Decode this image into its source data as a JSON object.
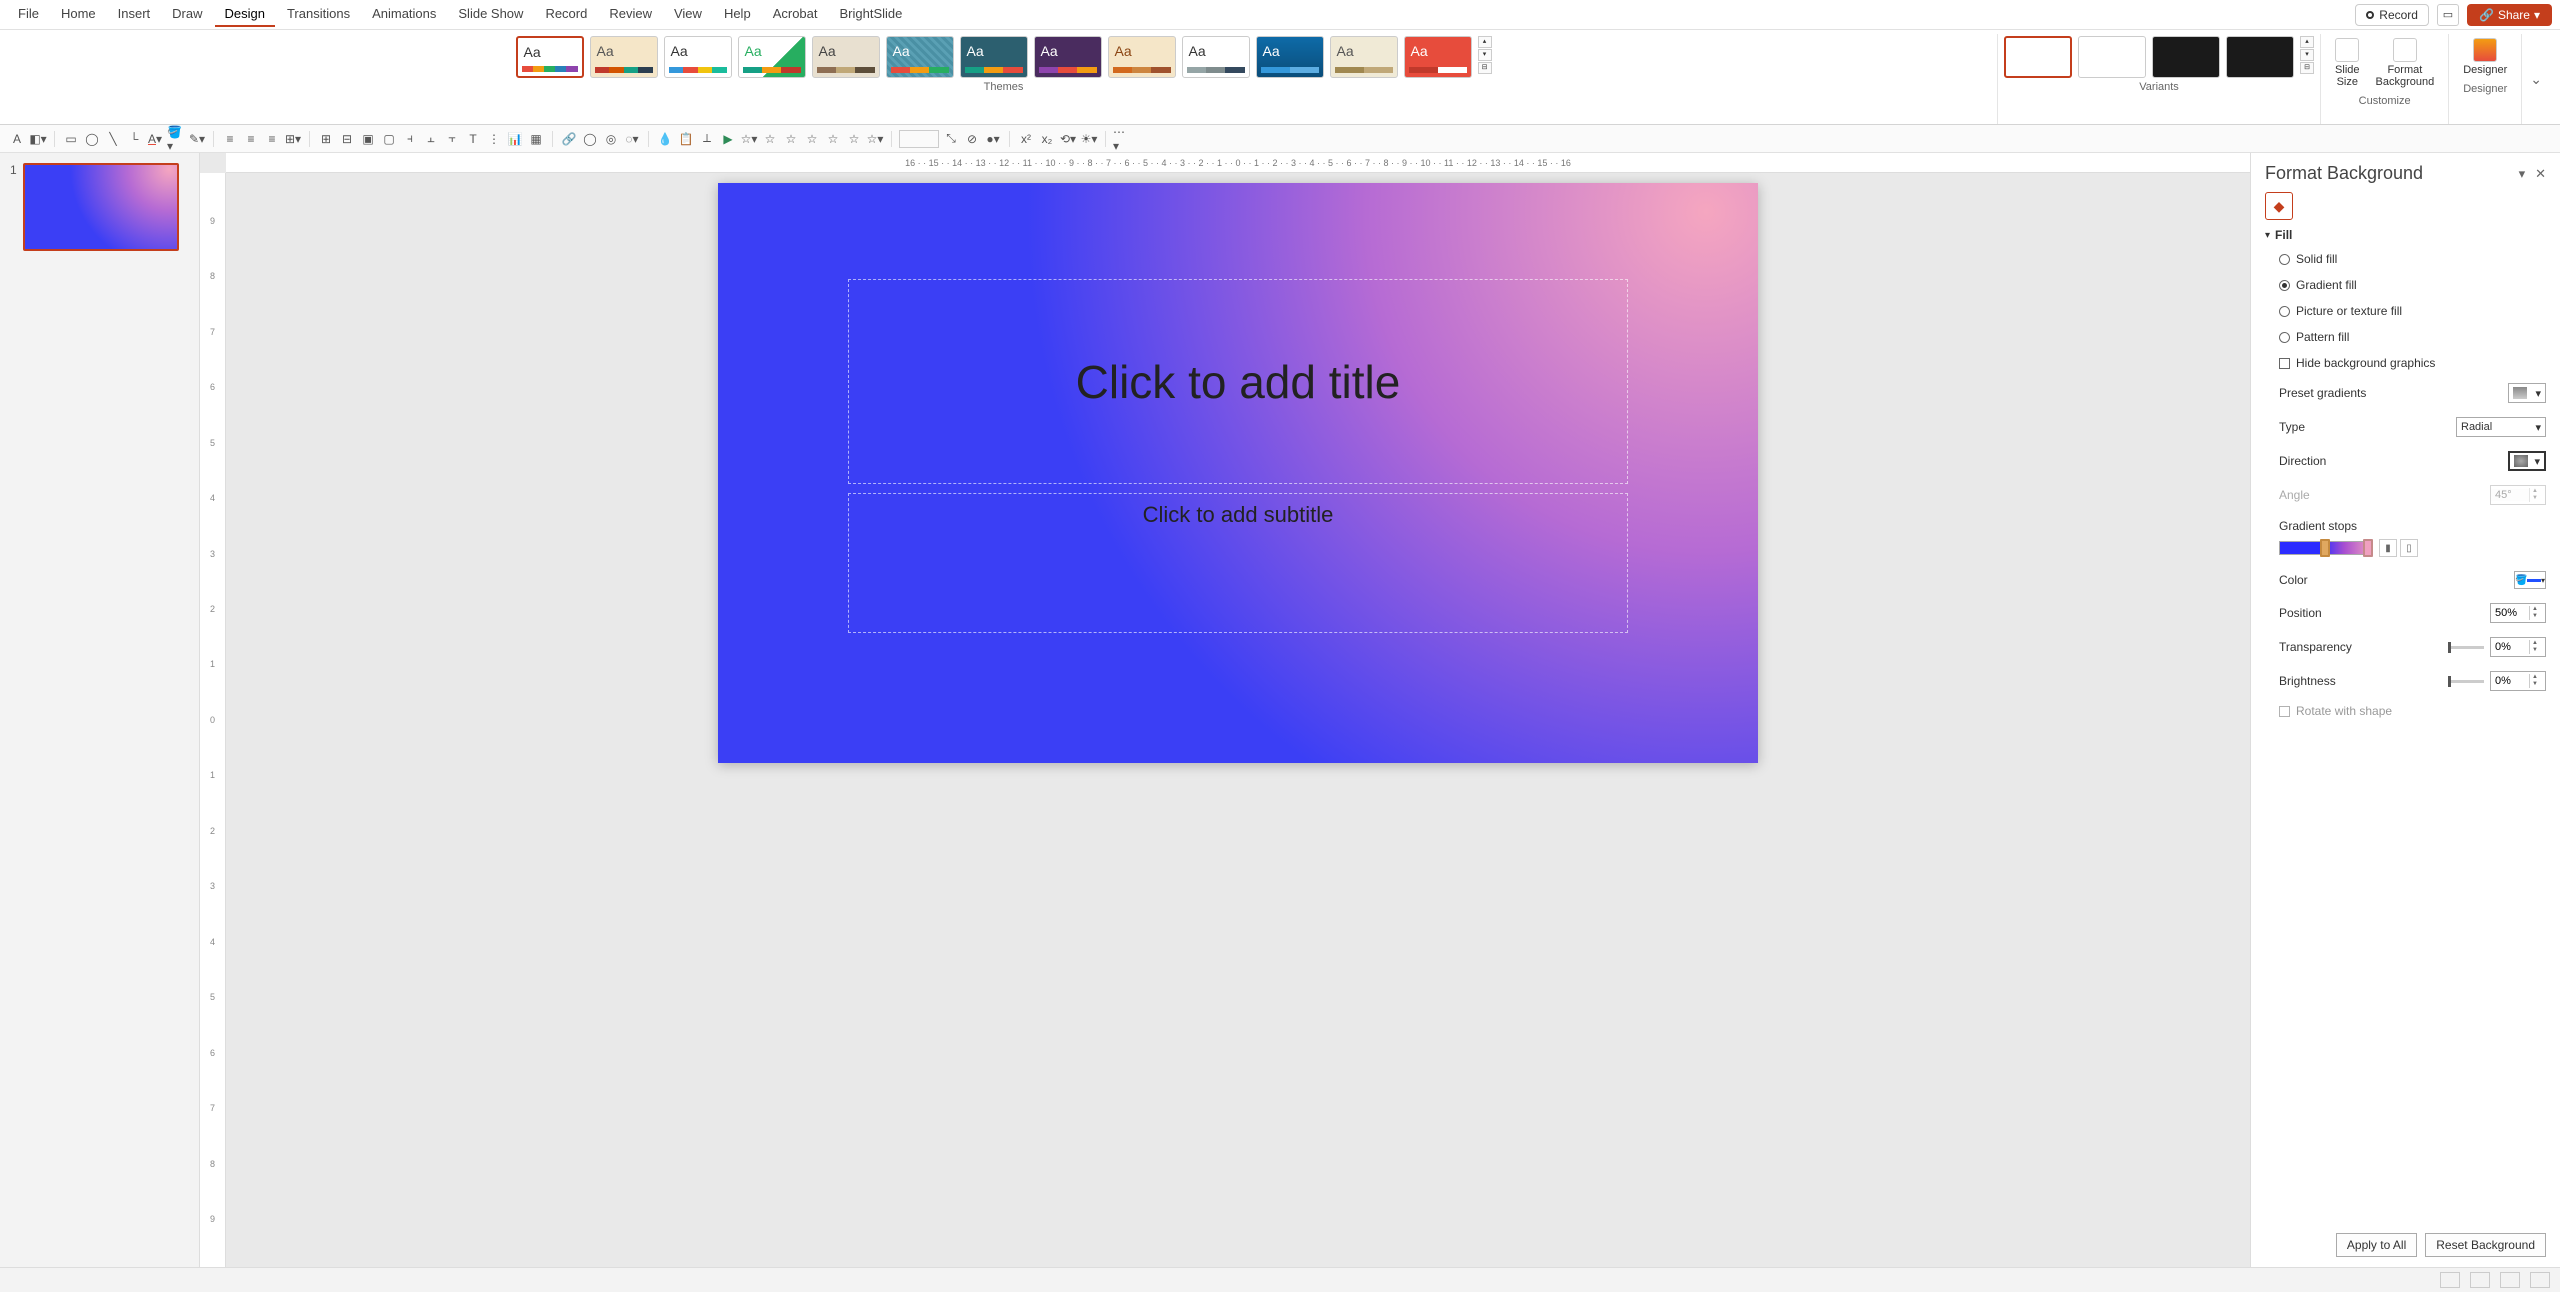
{
  "menu": {
    "tabs": [
      "File",
      "Home",
      "Insert",
      "Draw",
      "Design",
      "Transitions",
      "Animations",
      "Slide Show",
      "Record",
      "Review",
      "View",
      "Help",
      "Acrobat",
      "BrightSlide"
    ],
    "active": "Design",
    "record": "Record",
    "share": "Share"
  },
  "ribbon": {
    "themes_label": "Themes",
    "variants_label": "Variants",
    "customize_label": "Customize",
    "designer_label": "Designer",
    "slide_size": "Slide\nSize",
    "format_bg": "Format\nBackground",
    "designer": "Designer"
  },
  "slidepanel": {
    "num": "1"
  },
  "slide": {
    "title_ph": "Click to add title",
    "sub_ph": "Click to add subtitle"
  },
  "pane": {
    "title": "Format Background",
    "fill": "Fill",
    "solid": "Solid fill",
    "gradient": "Gradient fill",
    "picture": "Picture or texture fill",
    "pattern": "Pattern fill",
    "hide": "Hide background graphics",
    "preset": "Preset gradients",
    "type": "Type",
    "type_val": "Radial",
    "direction": "Direction",
    "angle": "Angle",
    "angle_val": "45°",
    "stops": "Gradient stops",
    "color": "Color",
    "position": "Position",
    "position_val": "50%",
    "transparency": "Transparency",
    "transparency_val": "0%",
    "brightness": "Brightness",
    "brightness_val": "0%",
    "rotate": "Rotate with shape",
    "apply_all": "Apply to All",
    "reset": "Reset Background"
  },
  "ruler": {
    "hticks": "16 · · 15 · · 14 · · 13 · · 12 · · 11 · · 10 · · 9 · · 8 · · 7 · · 6 · · 5 · · 4 · · 3 · · 2 · · 1 · · 0 · · 1 · · 2 · · 3 · · 4 · · 5 · · 6 · · 7 · · 8 · · 9 · · 10 · · 11 · · 12 · · 13 · · 14 · · 15 · · 16",
    "vticks": [
      "9",
      "8",
      "7",
      "6",
      "5",
      "4",
      "3",
      "2",
      "1",
      "0",
      "1",
      "2",
      "3",
      "4",
      "5",
      "6",
      "7",
      "8",
      "9"
    ]
  }
}
